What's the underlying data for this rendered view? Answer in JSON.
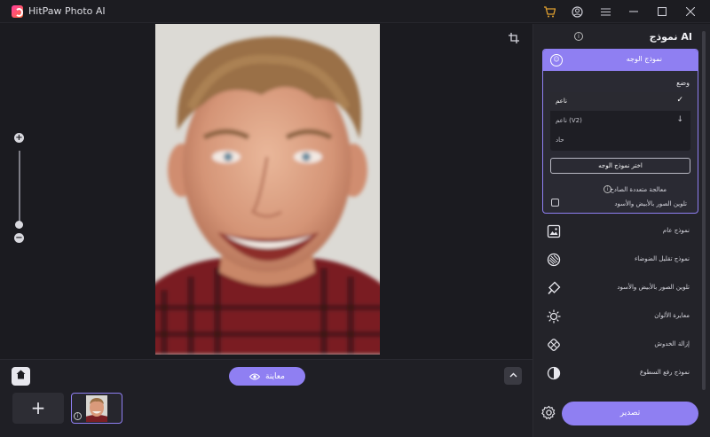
{
  "app": {
    "title": "HitPaw Photo AI"
  },
  "titlebar": {
    "icons": [
      "cart-icon",
      "account-icon",
      "menu-icon",
      "minimize-icon",
      "maximize-icon",
      "close-icon"
    ]
  },
  "canvas": {
    "zoom_plus": "+",
    "zoom_minus": "−"
  },
  "bottombar": {
    "preview_label": "معاينة",
    "add_label": "+"
  },
  "panel": {
    "title": "نموذج AI",
    "face_model": {
      "header": "نموذج الوجه",
      "mode_label": "وضع",
      "options": [
        {
          "label": "ناعم",
          "selected": true,
          "right": "✓"
        },
        {
          "label": "ناعم (V2)",
          "selected": false,
          "right": "↓"
        },
        {
          "label": "حاد",
          "selected": false,
          "right": ""
        }
      ],
      "select_button": "اختر نموذج الوجه",
      "batch_label": "معالجة متعددة الصادح",
      "bw_label": "تلوين الصور بالأبيض والأسود"
    },
    "models": [
      {
        "label": "نموذج عام",
        "icon": "image-icon"
      },
      {
        "label": "نموذج تقليل الضوضاء",
        "icon": "denoise-icon"
      },
      {
        "label": "تلوين الصور بالأبيض والأسود",
        "icon": "colorize-icon"
      },
      {
        "label": "معايرة الألوان",
        "icon": "color-calibration-icon"
      },
      {
        "label": "إزالة الخدوش",
        "icon": "scratch-removal-icon"
      },
      {
        "label": "نموذج رفع السطوع",
        "icon": "brightness-icon"
      }
    ],
    "export_label": "تصدير"
  },
  "colors": {
    "accent": "#8f7ff2",
    "background": "#1b1b20",
    "panel": "#232329"
  }
}
